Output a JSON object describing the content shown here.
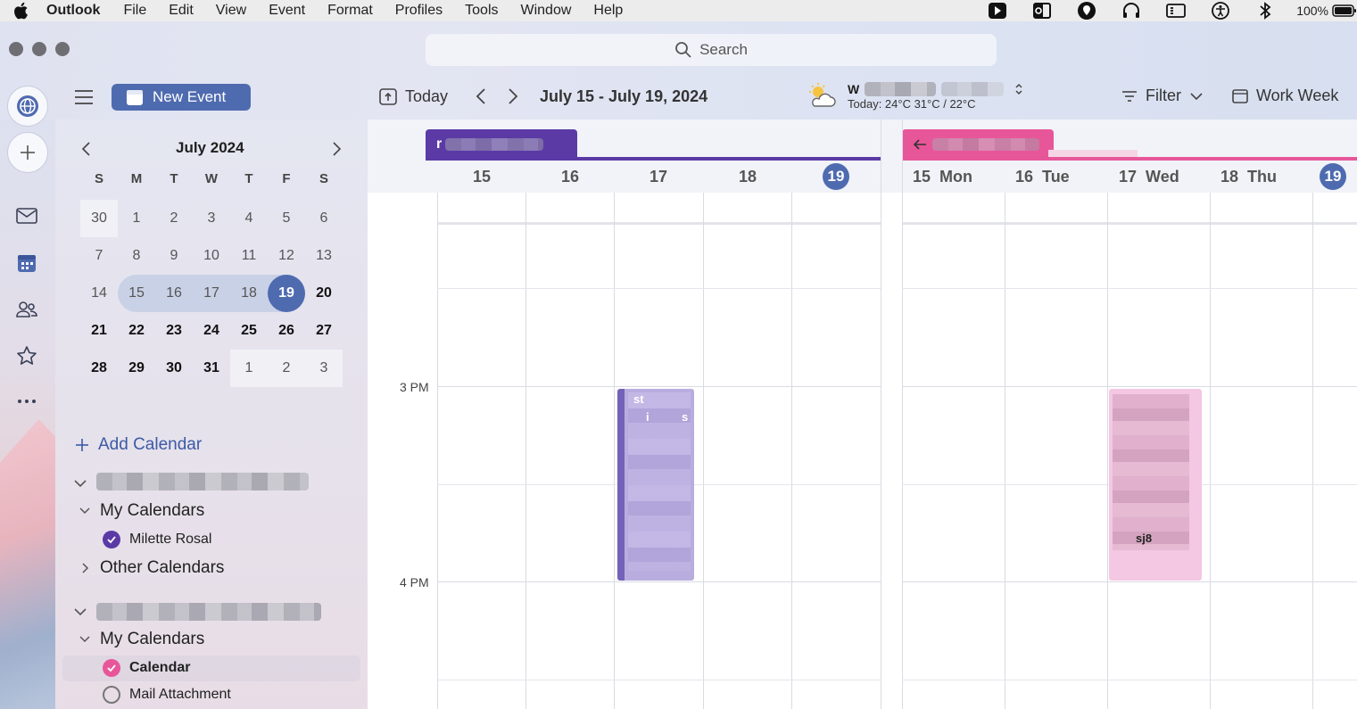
{
  "menubar": {
    "app_name": "Outlook",
    "items": [
      "File",
      "Edit",
      "View",
      "Event",
      "Format",
      "Profiles",
      "Tools",
      "Window",
      "Help"
    ],
    "battery": "100%"
  },
  "search": {
    "placeholder": "Search"
  },
  "toolbar": {
    "new_event": "New Event",
    "today": "Today",
    "date_range": "July 15 - July 19, 2024",
    "weather_title": "W",
    "weather_detail": "Today: 24°C  31°C / 22°C",
    "filter": "Filter",
    "view_mode": "Work Week"
  },
  "mini_calendar": {
    "title": "July 2024",
    "dow": [
      "S",
      "M",
      "T",
      "W",
      "T",
      "F",
      "S"
    ],
    "weeks": [
      [
        "30",
        "1",
        "2",
        "3",
        "4",
        "5",
        "6"
      ],
      [
        "7",
        "8",
        "9",
        "10",
        "11",
        "12",
        "13"
      ],
      [
        "14",
        "15",
        "16",
        "17",
        "18",
        "19",
        "20"
      ],
      [
        "21",
        "22",
        "23",
        "24",
        "25",
        "26",
        "27"
      ],
      [
        "28",
        "29",
        "30",
        "31",
        "1",
        "2",
        "3"
      ]
    ],
    "selected_day": "19"
  },
  "sidebar": {
    "add_calendar": "Add Calendar",
    "group1": {
      "my_calendars": "My Calendars",
      "person": "Milette Rosal",
      "other_calendars": "Other Calendars"
    },
    "group2": {
      "my_calendars": "My Calendars",
      "calendar": "Calendar",
      "mail_attachment": "Mail Attachment"
    }
  },
  "calendar_pane_1": {
    "tab_label": "r",
    "days": [
      "15",
      "16",
      "17",
      "18",
      "19"
    ]
  },
  "calendar_pane_2": {
    "days": [
      {
        "num": "15",
        "name": "Mon"
      },
      {
        "num": "16",
        "name": "Tue"
      },
      {
        "num": "17",
        "name": "Wed"
      },
      {
        "num": "18",
        "name": "Thu"
      },
      {
        "num": "19",
        "name": ""
      }
    ],
    "event_fragment": "sj8"
  },
  "time_labels": [
    "3 PM",
    "4 PM"
  ],
  "event_1_fragments": [
    "st",
    "i",
    "s"
  ],
  "colors": {
    "accent": "#4f6bb0",
    "purple_calendar": "#5b3aa6",
    "pink_calendar": "#e8569a",
    "purple_event": "#b9addf",
    "pink_event": "#f4c7e3"
  }
}
